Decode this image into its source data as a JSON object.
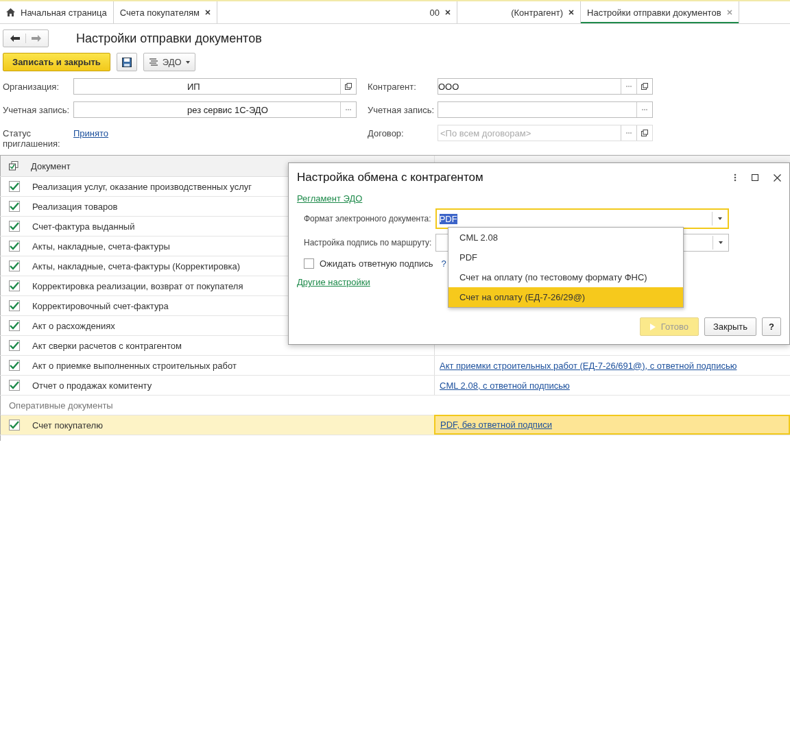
{
  "tabs": [
    {
      "kind": "home",
      "label": "Начальная страница",
      "selected": false
    },
    {
      "kind": "page",
      "label": "Счета покупателям",
      "selected": false
    },
    {
      "kind": "page",
      "label": "00",
      "selected": false
    },
    {
      "kind": "page",
      "label": "(Контрагент)",
      "selected": false
    },
    {
      "kind": "page",
      "label": "Настройки отправки документов",
      "selected": true
    }
  ],
  "form": {
    "title": "Настройки отправки документов",
    "save_close": "Записать и закрыть",
    "edo": "ЭДО",
    "left_fields": [
      {
        "kind": "field",
        "label": "Организация:",
        "value": "ИП",
        "select_button": false,
        "open_button": true
      },
      {
        "kind": "field",
        "label": "Учетная запись:",
        "value": "рез сервис 1С-ЭДО",
        "select_button": true,
        "open_button": false
      },
      {
        "kind": "link",
        "label": "Статус приглашения:",
        "value": "Принято"
      }
    ],
    "right_fields": [
      {
        "kind": "field",
        "label": "Контрагент:",
        "value": "ООО",
        "select_button": true,
        "open_button": true
      },
      {
        "kind": "field",
        "label": "Учетная запись:",
        "select_button": true,
        "open_button": false
      },
      {
        "kind": "field",
        "label": "Договор:",
        "placeholder": "<По всем договорам>",
        "select_button": true,
        "open_button": true
      }
    ]
  },
  "table": {
    "columns": [
      "Документ"
    ],
    "rows": [
      {
        "kind": "doc",
        "name": "Реализация услуг, оказание производственных услуг",
        "checked": true,
        "selected": false
      },
      {
        "kind": "doc",
        "name": "Реализация товаров",
        "checked": true,
        "selected": false
      },
      {
        "kind": "doc",
        "name": "Счет-фактура выданный",
        "checked": true,
        "selected": false
      },
      {
        "kind": "doc",
        "name": "Акты, накладные, счета-фактуры",
        "checked": true,
        "selected": false
      },
      {
        "kind": "doc",
        "name": "Акты, накладные, счета-фактуры (Корректировка)",
        "checked": true,
        "selected": false
      },
      {
        "kind": "doc",
        "name": "Корректировка реализации, возврат от покупателя",
        "checked": true,
        "selected": false
      },
      {
        "kind": "doc",
        "name": "Корректировочный счет-фактура",
        "checked": true,
        "selected": false
      },
      {
        "kind": "doc",
        "name": "Акт о расхождениях",
        "checked": true,
        "selected": false
      },
      {
        "kind": "doc",
        "name": "Акт сверки расчетов с контрагентом",
        "checked": true,
        "selected": false
      },
      {
        "kind": "doc",
        "name": "Акт о приемке выполненных строительных работ",
        "checked": true,
        "selected": false,
        "link": "Акт приемки строительных работ (ЕД-7-26/691@), с ответной подписью"
      },
      {
        "kind": "doc",
        "name": "Отчет о продажах комитенту",
        "checked": true,
        "selected": false,
        "link": "CML 2.08, с ответной подписью"
      },
      {
        "kind": "group",
        "name": "Оперативные документы"
      },
      {
        "kind": "doc",
        "name": "Счет покупателю",
        "checked": true,
        "selected": true,
        "link": "PDF, без ответной подписи"
      }
    ]
  },
  "dialog": {
    "title": "Настройка обмена с контрагентом",
    "link_top": "Регламент ЭДО",
    "format_label": "Формат электронного документа:",
    "format_value": "PDF",
    "route_label": "Настройка подпись по маршруту:",
    "wait_sign": {
      "label": "Ожидать ответную подпись",
      "checked": false
    },
    "help_mark": "?",
    "link_bottom": "Другие настройки",
    "options": [
      {
        "label": "CML 2.08",
        "selected": false
      },
      {
        "label": "PDF",
        "selected": false
      },
      {
        "label": "Счет на оплату (по тестовому формату ФНС)",
        "selected": false
      },
      {
        "label": "Счет на оплату (ЕД-7-26/29@)",
        "selected": true
      }
    ],
    "buttons": [
      {
        "kind": "done",
        "label": "Готово",
        "disabled": true
      },
      {
        "kind": "close",
        "label": "Закрыть",
        "disabled": false
      },
      {
        "kind": "help",
        "label": "?",
        "disabled": false
      }
    ]
  }
}
